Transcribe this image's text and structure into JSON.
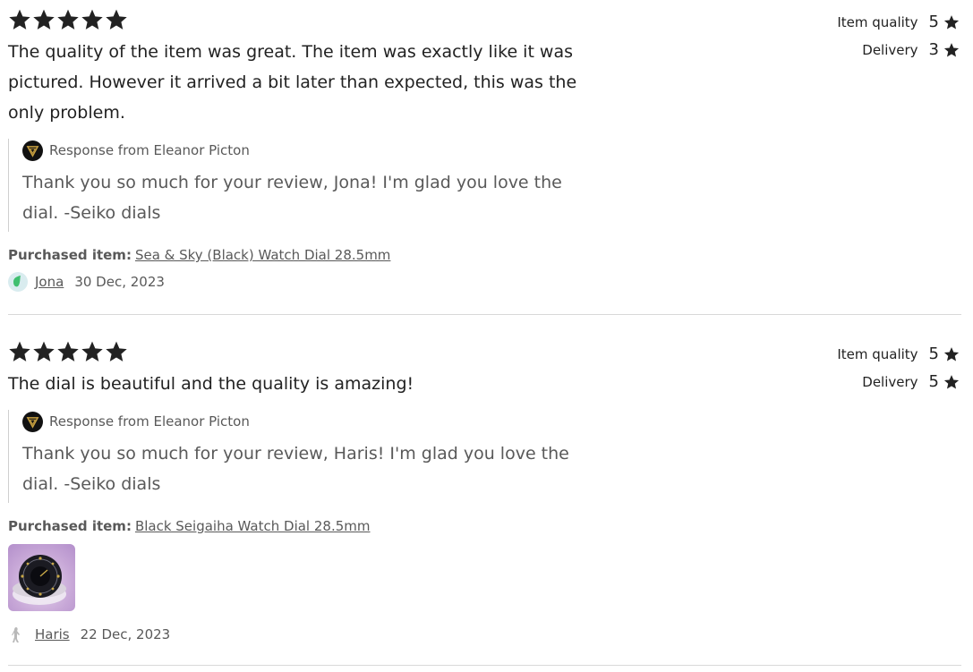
{
  "reviews": [
    {
      "star_rating": 5,
      "text": "The quality of the item was great. The item was exactly like it was pictured. However it arrived a bit later than expected, this was the only problem.",
      "ratings": [
        {
          "label": "Item quality",
          "value": "5"
        },
        {
          "label": "Delivery",
          "value": "3"
        }
      ],
      "response": {
        "from": "Response from Eleanor Picton",
        "text": "Thank you so much for your review, Jona! I'm glad you love the dial. -Seiko dials"
      },
      "purchased_label": "Purchased item:",
      "purchased_item": "Sea & Sky (Black) Watch Dial 28.5mm",
      "reviewer": "Jona",
      "date": "30 Dec, 2023",
      "avatar_color": "#3fbf6f"
    },
    {
      "star_rating": 5,
      "text": "The dial is beautiful and the quality is amazing!",
      "ratings": [
        {
          "label": "Item quality",
          "value": "5"
        },
        {
          "label": "Delivery",
          "value": "5"
        }
      ],
      "response": {
        "from": "Response from Eleanor Picton",
        "text": "Thank you so much for your review, Haris! I'm glad you love the dial. -Seiko dials"
      },
      "purchased_label": "Purchased item:",
      "purchased_item": "Black Seigaiha Watch Dial 28.5mm",
      "reviewer": "Haris",
      "date": "22 Dec, 2023",
      "has_photo": true
    }
  ],
  "colors": {
    "text": "#222222",
    "muted": "#595959",
    "divider": "#d8d8d8",
    "logo_gold": "#c8a040"
  }
}
